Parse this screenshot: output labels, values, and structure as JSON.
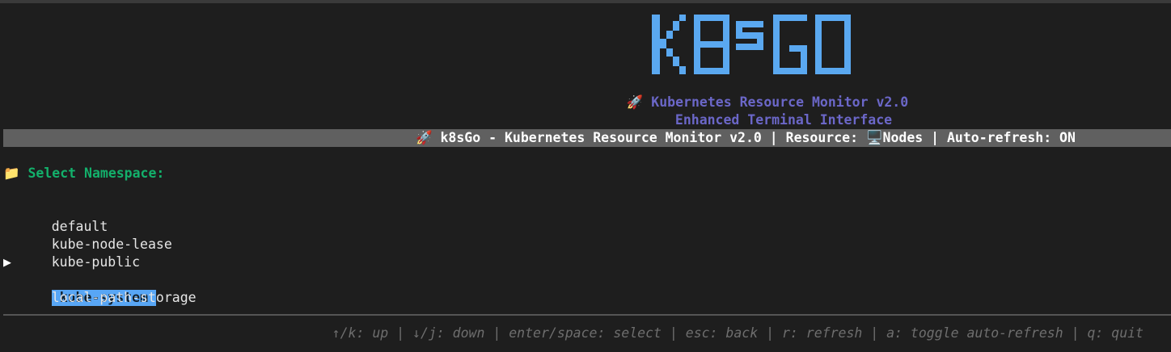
{
  "app": {
    "logo_text": "k8sGO",
    "subtitle_line1": "🚀 Kubernetes Resource Monitor v2.0",
    "subtitle_line2": "Enhanced Terminal Interface"
  },
  "status_bar": {
    "text": "🚀 k8sGo - Kubernetes Resource Monitor v2.0 | Resource: 🖥️Nodes | Auto-refresh: ON"
  },
  "namespace_picker": {
    "title": "📁 Select Namespace:",
    "cursor_glyph": "▶",
    "items": [
      {
        "label": "default",
        "selected": false
      },
      {
        "label": "kube-node-lease",
        "selected": false
      },
      {
        "label": "kube-public",
        "selected": false
      },
      {
        "label": "kube-system",
        "selected": true
      },
      {
        "label": "local-path-storage",
        "selected": false
      }
    ]
  },
  "footer": {
    "help_text": "↑/k: up | ↓/j: down | enter/space: select | esc: back | r: refresh | a: toggle auto-refresh | q: quit"
  },
  "colors": {
    "background": "#1e1e1e",
    "logo": "#5aa8f0",
    "subtitle": "#6b67c8",
    "status_bar_bg": "#606060",
    "namespace_title": "#13b06b",
    "selected_bg": "#58a6f5",
    "help_text": "#6e6e6e"
  }
}
